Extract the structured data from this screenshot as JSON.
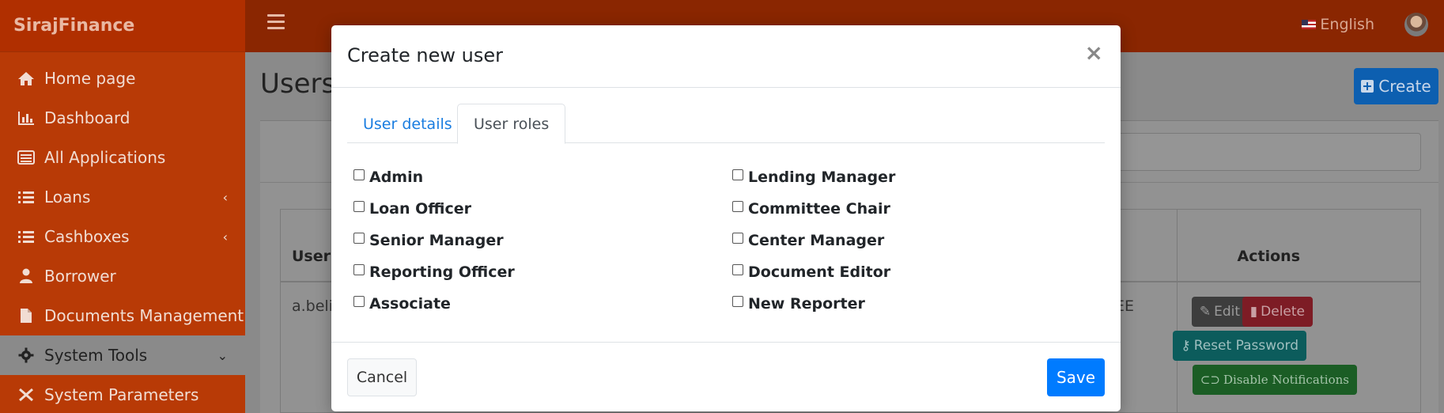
{
  "app": {
    "brand": "SirajFinance"
  },
  "sidebar": {
    "items": [
      {
        "label": "Home page",
        "icon": "home-icon"
      },
      {
        "label": "Dashboard",
        "icon": "bar-chart-icon"
      },
      {
        "label": "All Applications",
        "icon": "list-alt-icon"
      },
      {
        "label": "Loans",
        "icon": "list-icon",
        "chevron": "‹"
      },
      {
        "label": "Cashboxes",
        "icon": "list-icon",
        "chevron": "‹"
      },
      {
        "label": "Borrower",
        "icon": "user-icon"
      },
      {
        "label": "Documents Management",
        "icon": "file-icon"
      },
      {
        "label": "System Tools",
        "icon": "gear-icon",
        "chevron": "⌄"
      },
      {
        "label": "System Parameters",
        "icon": "wrench-icon"
      }
    ]
  },
  "header": {
    "language": "English"
  },
  "page": {
    "title": "Users",
    "create_label": "Create",
    "table": {
      "col_user": "User n",
      "col_actions": "Actions",
      "row_user": "a.belia",
      "row_role": "TEE",
      "edit_label": "Edit",
      "delete_label": "Delete",
      "reset_label": "Reset Password",
      "notif_label": "Disable Notifications"
    }
  },
  "modal": {
    "title": "Create new user",
    "close": "×",
    "tabs": [
      "User details",
      "User roles"
    ],
    "active_tab": "User roles",
    "roles_left": [
      "Admin",
      "Loan Officer",
      "Senior Manager",
      "Reporting Officer",
      "Associate"
    ],
    "roles_right": [
      "Lending Manager",
      "Committee Chair",
      "Center Manager",
      "Document Editor",
      "New Reporter"
    ],
    "cancel_label": "Cancel",
    "save_label": "Save"
  },
  "colors": {
    "brand": "#b83a06",
    "primary": "#007bff",
    "link": "#1a7de0"
  }
}
